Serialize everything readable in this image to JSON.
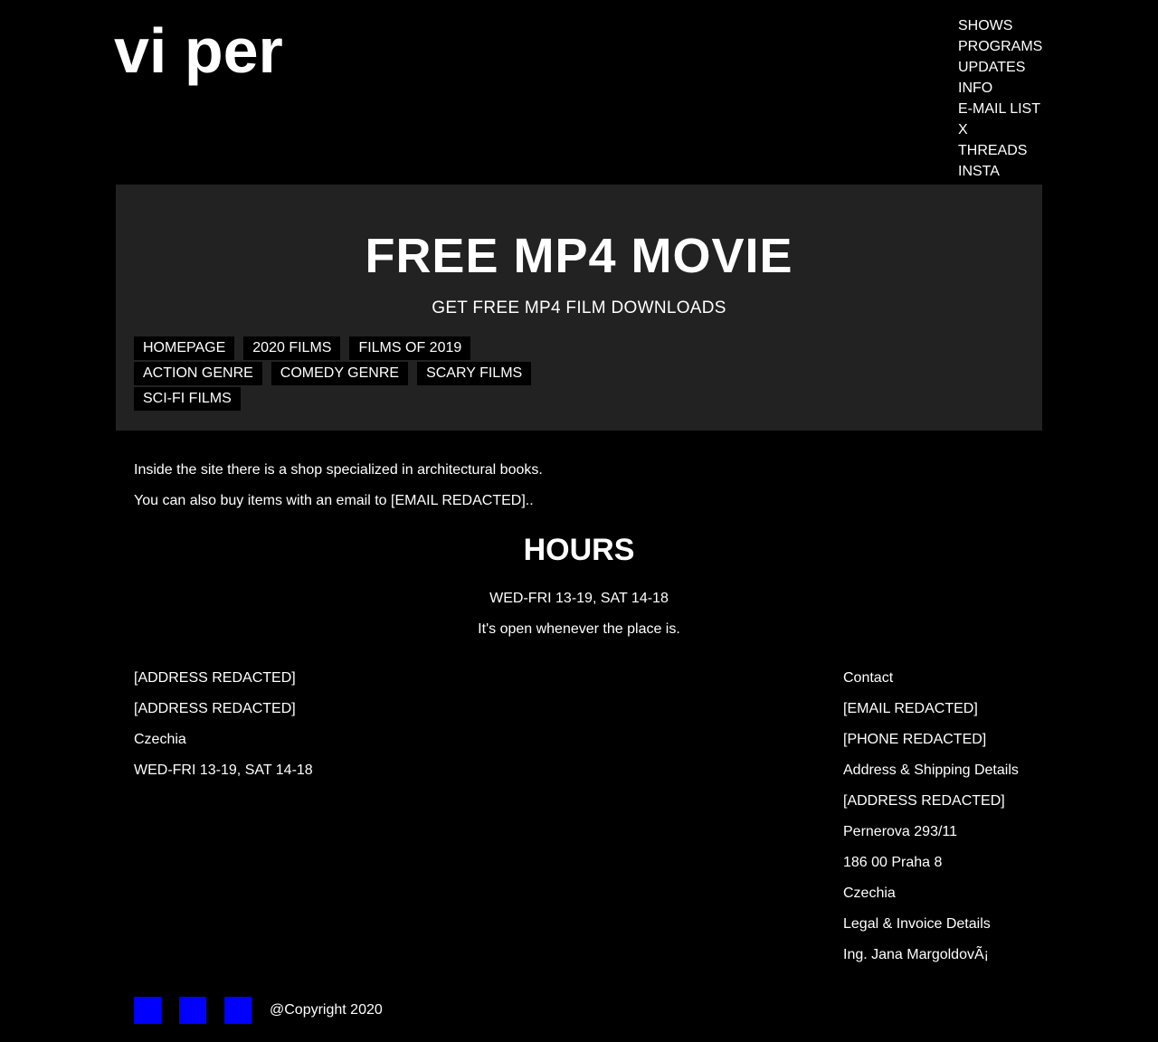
{
  "site": {
    "logo": "vi per"
  },
  "topnav": {
    "items": [
      "SHOWS",
      "PROGRAMS",
      "UPDATES",
      "INFO",
      "E-MAIL LIST",
      "X",
      "THREADS",
      "INSTA"
    ]
  },
  "hero": {
    "title": "FREE MP4 MOVIE",
    "subtitle": "GET FREE MP4 FILM DOWNLOADS",
    "categories": [
      [
        "HOMEPAGE",
        "2020 FILMS",
        "FILMS OF 2019"
      ],
      [
        "ACTION GENRE",
        "COMEDY GENRE",
        "SCARY FILMS"
      ],
      [
        "SCI-FI FILMS"
      ]
    ]
  },
  "intro": {
    "line1": "Inside the site there is a shop specialized in architectural books.",
    "line2": "You can also buy items with an email to [EMAIL REDACTED].."
  },
  "hours": {
    "title": "HOURS",
    "schedule": "WED-FRI 13-19, SAT 14-18",
    "note": "It's open whenever the place is."
  },
  "address": {
    "lines": [
      "[ADDRESS REDACTED]",
      "[ADDRESS REDACTED]",
      "Czechia",
      "WED-FRI 13-19, SAT 14-18"
    ]
  },
  "contact": {
    "lines": [
      "Contact",
      "[EMAIL REDACTED]",
      "[PHONE REDACTED]",
      "Address & Shipping Details",
      "[ADDRESS REDACTED]",
      "Pernerova 293/11",
      "186 00 Praha 8",
      "Czechia",
      "Legal & Invoice Details",
      "Ing. Jana MargoldovÃ¡"
    ]
  },
  "footer": {
    "social_icons": [
      "social-icon-1",
      "social-icon-2",
      "social-icon-3"
    ],
    "social_color": "#0000ff",
    "copyright": "@Copyright 2020"
  },
  "colors": {
    "background": "#000000",
    "hero_background": "#222222",
    "text": "#ffffff",
    "category_background": "#000000"
  }
}
